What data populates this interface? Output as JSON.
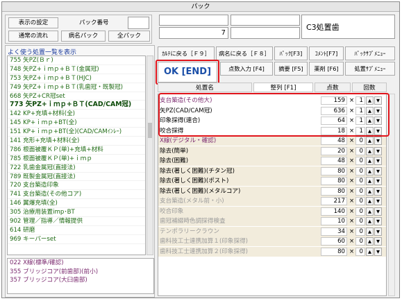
{
  "window": {
    "title": "パック"
  },
  "topleft": {
    "display_settings": "表示の設定",
    "pack_number_label": "パック番号",
    "normal_flow": "通常の流れ",
    "disease_pack": "病名パック",
    "all_pack": "全パック"
  },
  "top": {
    "number_value": "7",
    "tooth_label": "C3処置歯"
  },
  "sidebar": {
    "header": "よく使う処置一覧を表示",
    "items": [
      "755  矢PZ(Ｂｒ)",
      "748  矢PZ+ｉｍｐ+ＢＴ(金属冠)",
      "753  矢PZ+ｉｍｐ+ＢＴ(HJC)",
      "749  矢PZ+ｉｍｐ+ＢＴ(乳歯冠・既製冠)",
      "668  矢PZ+CR冠set",
      "773  矢PZ+ｉｍｐ+ＢＴ(CAD/CAM冠)",
      "142  KP+充填+材料(全)",
      "145  KP+ｉｍｐ+BT(全)",
      "151  KP+ｉｍｐ+BT(全)(CAD/CAMｲﾝﾚｰ)",
      "141  充形+充填+材料(全)",
      "786  根面被覆ＫＰ(単)+充填+材料",
      "785  根面被覆ＫＰ(単)+ｉｍｐ",
      "722  乳歯金属冠(直接法)",
      "789  既製金属冠(直接法)",
      "720  支台築造印象",
      "741  支台築造(その他コア)",
      "146  翼爆充填(全)",
      "305  治療用装置imp･BT",
      "902  管理／指導／情報提供",
      "614  研磨",
      "969  キーパーset"
    ],
    "selected_index": 5,
    "bottom_items": [
      "022  X線(標準/確認)",
      "355  ブリッジコア(前歯部)(前小)",
      "357  ブリッジコア(大臼歯部)"
    ]
  },
  "buttons": {
    "back_to_karte": "ｶﾙﾃに戻る［Ｆ９］",
    "back_to_disease": "病名に戻る［Ｆ８］",
    "pack": "ﾊﾟｯｸ[F3]",
    "comment": "ｺﾒﾝﾄ[F7]",
    "pack_submenu": "ﾊﾟｯｸｻﾌﾞﾒﾆｭｰ",
    "ok_end": "OK [END]",
    "points_input": "点数入力 [F4]",
    "summary": "摘要 [F5]",
    "medication": "薬剤 [F6]",
    "treatment_submenu": "処置ｻﾌﾞﾒﾆｭｰ"
  },
  "grid": {
    "headers": {
      "name": "処置名",
      "sort": "整列 [F1]",
      "points": "点数",
      "count": "回数"
    },
    "rows": [
      {
        "name": "支台築造(その他大)",
        "points": "159",
        "count": "1",
        "style": "purple",
        "bg": "white"
      },
      {
        "name": "矢PZ(CAD/CAM冠)",
        "points": "636",
        "count": "1",
        "style": "dark",
        "bg": "white"
      },
      {
        "name": "印象採得(連合)",
        "points": "64",
        "count": "1",
        "style": "dark",
        "bg": "white"
      },
      {
        "name": "咬合採得",
        "points": "18",
        "count": "1",
        "style": "dark",
        "bg": "white"
      },
      {
        "name": "X線(デジタル・確認)",
        "points": "48",
        "count": "0",
        "style": "purple",
        "bg": "tan"
      },
      {
        "name": "除去(簡単)",
        "points": "20",
        "count": "0",
        "style": "dark",
        "bg": "tan"
      },
      {
        "name": "除去(困難)",
        "points": "48",
        "count": "0",
        "style": "dark",
        "bg": "tan"
      },
      {
        "name": "除去(著しく困難)(チタン冠)",
        "points": "80",
        "count": "0",
        "style": "dark",
        "bg": "tan"
      },
      {
        "name": "除去(著しく困難)(ポスト)",
        "points": "80",
        "count": "0",
        "style": "dark",
        "bg": "tan"
      },
      {
        "name": "除去(著しく困難)(メタルコア)",
        "points": "80",
        "count": "0",
        "style": "dark",
        "bg": "tan"
      },
      {
        "name": "支台築造(メタル前・小)",
        "points": "217",
        "count": "0",
        "style": "grey",
        "bg": "tan"
      },
      {
        "name": "咬合印象",
        "points": "140",
        "count": "0",
        "style": "grey",
        "bg": "tan"
      },
      {
        "name": "歯冠補綴時色調採得検査",
        "points": "10",
        "count": "0",
        "style": "grey",
        "bg": "tan"
      },
      {
        "name": "テンポラリークラウン",
        "points": "34",
        "count": "0",
        "style": "grey",
        "bg": "tan"
      },
      {
        "name": "歯科技工士連携加算１(印象採得)",
        "points": "60",
        "count": "0",
        "style": "grey",
        "bg": "tan"
      },
      {
        "name": "歯科技工士連携加算２(印象採得)",
        "points": "80",
        "count": "0",
        "style": "grey",
        "bg": "tan"
      }
    ]
  },
  "glyphs": {
    "times": "×",
    "up": "▲",
    "down": "▼"
  }
}
